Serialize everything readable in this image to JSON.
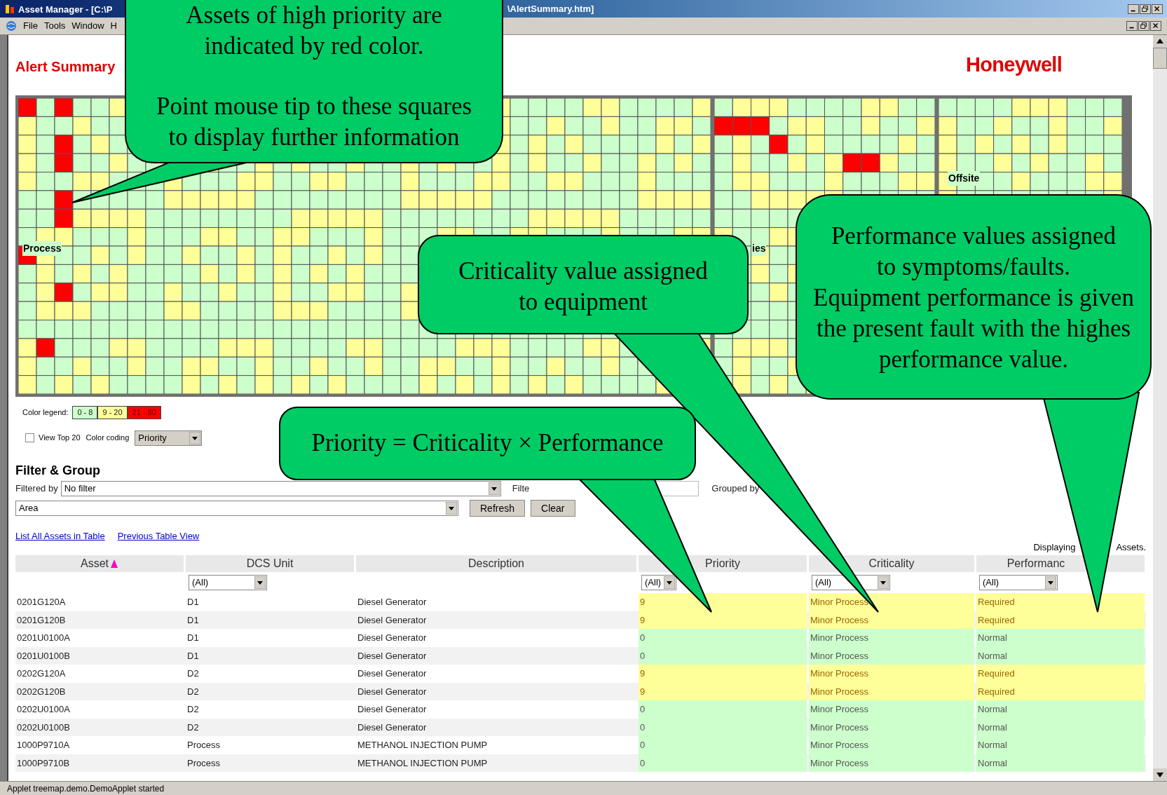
{
  "window": {
    "title_left": "Asset Manager - [C:\\P",
    "title_right": "\\AlertSummary.htm]"
  },
  "menu": [
    "File",
    "Tools",
    "Window",
    "H"
  ],
  "header": {
    "title": "Alert Summary",
    "logo": "Honeywell"
  },
  "treemap": {
    "labels": [
      "Process",
      "ies",
      "Offsite"
    ]
  },
  "legend": {
    "label": "Color legend:",
    "ranges": [
      {
        "text": "0 - 8",
        "color": "#ccffcc"
      },
      {
        "text": "9 - 20",
        "color": "#ffff99"
      },
      {
        "text": "21 - 80",
        "color": "#ff0000"
      }
    ]
  },
  "options": {
    "view_top": {
      "label": "View Top 20",
      "checked": false
    },
    "color_coding_label": "Color coding",
    "color_coding": "Priority"
  },
  "filter": {
    "title": "Filter & Group",
    "filtered_by_label": "Filtered by",
    "filtered_by": "No filter",
    "filter_label": "Filte",
    "grouped_by_label": "Grouped by",
    "grouped_by": "Area",
    "buttons": [
      "Refresh",
      "Clear"
    ]
  },
  "links": [
    "List All Assets in Table",
    "Previous Table View"
  ],
  "displaying": [
    "Displaying",
    "Assets."
  ],
  "table": {
    "columns": [
      {
        "label": "Asset",
        "sorted": true
      },
      {
        "label": "DCS Unit",
        "sorted": false,
        "filter": "(All)"
      },
      {
        "label": "Description",
        "sorted": false
      },
      {
        "label": "Priority",
        "sorted": false,
        "filter": "(All)"
      },
      {
        "label": "Criticality",
        "sorted": false,
        "filter": "(All)"
      },
      {
        "label": "Performanc",
        "sorted": false,
        "filter": "(All)"
      }
    ],
    "rows": [
      {
        "cells": [
          "0201G120A",
          "D1",
          "Diesel Generator",
          "9",
          "Minor Process",
          "Required"
        ],
        "color": "#ffff99"
      },
      {
        "cells": [
          "0201G120B",
          "D1",
          "Diesel Generator",
          "9",
          "Minor Process",
          "Required"
        ],
        "color": "#ffff99"
      },
      {
        "cells": [
          "0201U0100A",
          "D1",
          "Diesel Generator",
          "0",
          "Minor Process",
          "Normal"
        ],
        "color": "#ccffcc"
      },
      {
        "cells": [
          "0201U0100B",
          "D1",
          "Diesel Generator",
          "0",
          "Minor Process",
          "Normal"
        ],
        "color": "#ccffcc"
      },
      {
        "cells": [
          "0202G120A",
          "D2",
          "Diesel Generator",
          "9",
          "Minor Process",
          "Required"
        ],
        "color": "#ffff99"
      },
      {
        "cells": [
          "0202G120B",
          "D2",
          "Diesel Generator",
          "9",
          "Minor Process",
          "Required"
        ],
        "color": "#ffff99"
      },
      {
        "cells": [
          "0202U0100A",
          "D2",
          "Diesel Generator",
          "0",
          "Minor Process",
          "Normal"
        ],
        "color": "#ccffcc"
      },
      {
        "cells": [
          "0202U0100B",
          "D2",
          "Diesel Generator",
          "0",
          "Minor Process",
          "Normal"
        ],
        "color": "#ccffcc"
      },
      {
        "cells": [
          "1000P9710A",
          "Process",
          "METHANOL INJECTION PUMP",
          "0",
          "Minor Process",
          "Normal"
        ],
        "color": "#ccffcc"
      },
      {
        "cells": [
          "1000P9710B",
          "Process",
          "METHANOL INJECTION PUMP",
          "0",
          "Minor Process",
          "Normal"
        ],
        "color": "#ccffcc"
      }
    ]
  },
  "status_bar": "Applet treemap.demo.DemoApplet started",
  "callouts": [
    {
      "paragraphs": [
        [
          "Assets of high priority are",
          "indicated by red color."
        ],
        [
          "Point mouse tip to these squares",
          "to display further information"
        ]
      ]
    },
    {
      "paragraphs": [
        [
          "Criticality value assigned",
          "to equipment"
        ]
      ]
    },
    {
      "paragraphs": [
        [
          "Priority = Criticality × Performance"
        ]
      ]
    },
    {
      "paragraphs": [
        [
          "Performance values assigned",
          "to symptoms/faults.",
          "Equipment performance is given",
          "the present fault with the highes",
          "performance value."
        ]
      ]
    }
  ]
}
